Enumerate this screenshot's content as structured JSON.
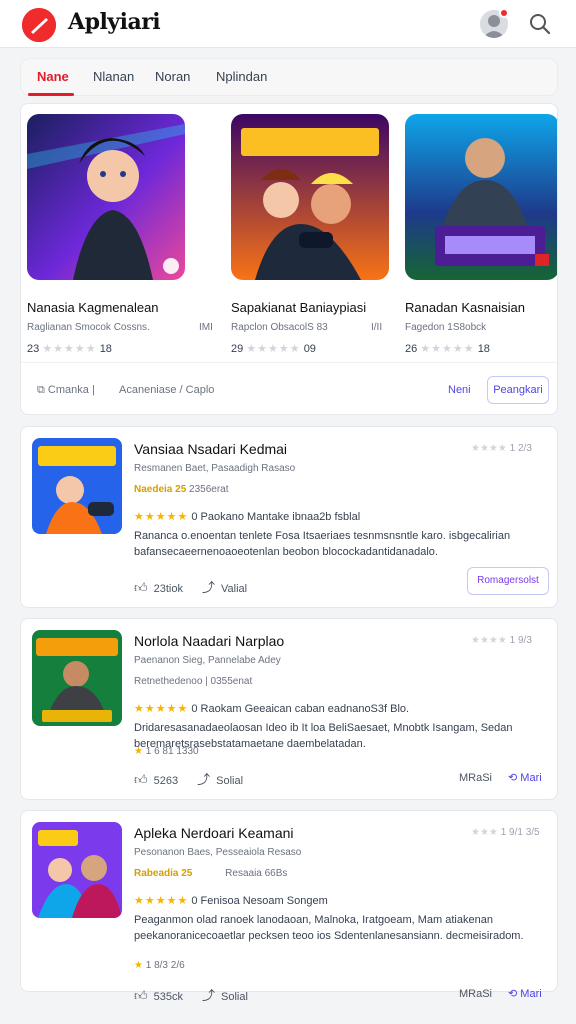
{
  "app": {
    "title": "Aplyiari"
  },
  "tabs": [
    {
      "label": "Nane"
    },
    {
      "label": "Nlanan"
    },
    {
      "label": "Noran"
    },
    {
      "label": "Nplindan"
    }
  ],
  "featured": {
    "items": [
      {
        "title": "Nanasia Kagmenalean",
        "subtitle": "Raglianan Smocok Cossns.",
        "tag": "IMI",
        "rating": "23",
        "rating_suffix": "18"
      },
      {
        "title": "Sapakianat Baniaypiasi",
        "subtitle": "Rapclon ObsacolS  83",
        "tag": "I/II",
        "rating": "29",
        "rating_suffix": "09"
      },
      {
        "title": "Ranadan Kasnaisian",
        "subtitle": "Fagedon 1S8obck",
        "tag": "",
        "rating": "26",
        "rating_suffix": "18"
      }
    ],
    "footer_left": "Cmanka |",
    "footer_mid": "Acaneniase / Caplo",
    "link_label": "Neni",
    "button_label": "Peangkari"
  },
  "reviews": [
    {
      "title": "Vansiaa Nsadari Kedmai",
      "meta": "1 2/3",
      "sub1": "Resmanen Baet, Pasaadigh Rasaso",
      "sub2_hl": "Naedeia 25",
      "sub2_rest": "2356erat",
      "stars_label": "0  Paokano Mantake ibnaa2b fsblal",
      "desc": "Rananca o.enoentan tenlete Fosa Itsaeriaes tesnmsnsntle karo. isbgecalirian bafansecaeernenoaoeotenlan beobon blocockadantidanadalo.",
      "small": "",
      "likes": "23tiok",
      "shares": "Valial",
      "button_label": "Romagersolst",
      "link1": "",
      "link2": ""
    },
    {
      "title": "Norlola Naadari Narplao",
      "meta": "1 9/3",
      "sub1": "Paenanon Sieg, Pannelabe Adey",
      "sub2_hl": "",
      "sub2_rest": "Retnethedenoo  |  0355enat",
      "stars_label": "0  Raokam Geeaican caban eadnanoS3f Blo.",
      "desc": "Dridaresasanadaeolaosan Ideo ib It loa BeliSaesaet, Mnobtk Isangam, Sedan beremaretsrasebstatamaetane daembelatadan.",
      "small": "1 6 81 1330",
      "likes": "5263",
      "shares": "Solial",
      "button_label": "",
      "link1": "MRaSi",
      "link2": "Mari"
    },
    {
      "title": "Apleka Nerdoari Keamani",
      "meta": "1 9/1 3/5",
      "sub1": "Pesonanon Baes, Pesseaiola Resaso",
      "sub2_hl": "Rabeadia 25",
      "sub2_rest": "Resaaia 66Bs",
      "stars_label": "0  Fenisoa Nesoam                      Songem",
      "desc": "Peaganmon olad ranoek lanodaoan, Malnoka, Iratgoeam, Mam atiakenan peekanoranicecoaetlar pecksen teoo ios Sdentenlanesansiann. decmeisiradom.",
      "small": "1 8/3 2/6",
      "likes": "535ck",
      "shares": "Solial",
      "button_label": "",
      "link1": "MRaSi",
      "link2": "Mari"
    }
  ],
  "colors": {
    "accent": "#e11d2a",
    "link": "#4f46e5",
    "star": "#f5b400"
  }
}
